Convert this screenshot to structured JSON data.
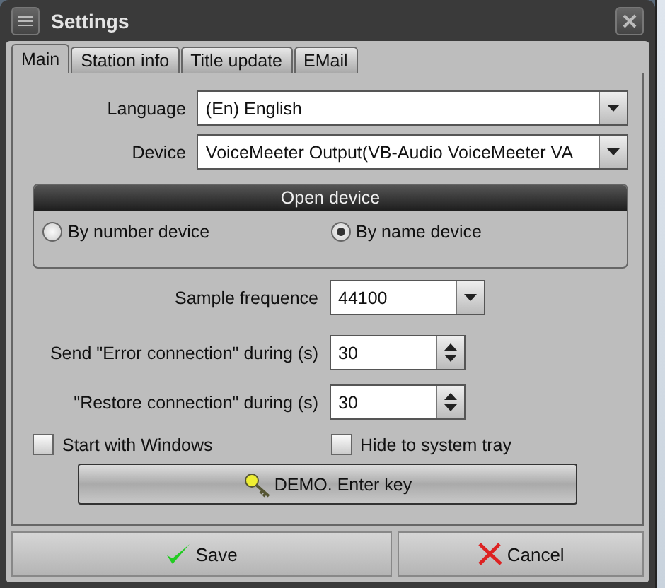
{
  "window": {
    "title": "Settings"
  },
  "tabs": [
    {
      "label": "Main",
      "selected": true
    },
    {
      "label": "Station info",
      "selected": false
    },
    {
      "label": "Title update",
      "selected": false
    },
    {
      "label": "EMail",
      "selected": false
    }
  ],
  "language": {
    "label": "Language",
    "value": "(En) English"
  },
  "device": {
    "label": "Device",
    "value": "VoiceMeeter Output(VB-Audio VoiceMeeter VA"
  },
  "open_device": {
    "title": "Open device",
    "options": [
      {
        "label": "By number device",
        "selected": false
      },
      {
        "label": "By name device",
        "selected": true
      }
    ]
  },
  "sample_frequence": {
    "label": "Sample frequence",
    "value": "44100"
  },
  "error_connection": {
    "label": "Send \"Error connection\" during (s)",
    "value": "30"
  },
  "restore_connection": {
    "label": "\"Restore connection\" during (s)",
    "value": "30"
  },
  "checkboxes": [
    {
      "label": "Start with Windows",
      "checked": false
    },
    {
      "label": "Hide to system tray",
      "checked": false
    }
  ],
  "demo_button": "DEMO. Enter key",
  "buttons": [
    {
      "kind": "save",
      "label": "Save"
    },
    {
      "kind": "cancel",
      "label": "Cancel"
    }
  ]
}
